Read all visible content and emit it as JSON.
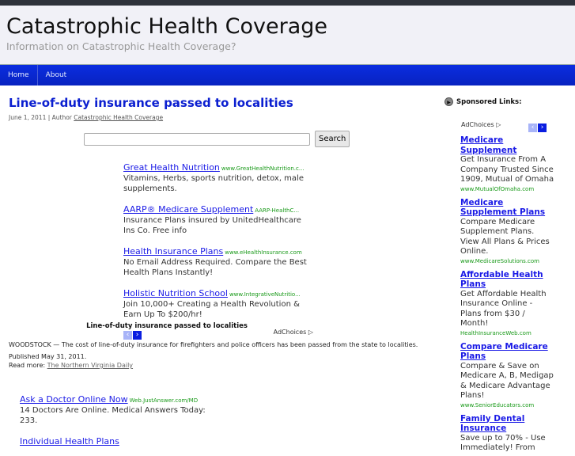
{
  "header": {
    "title": "Catastrophic Health Coverage",
    "tagline": "Information on Catastrophic Health Coverage?"
  },
  "nav": [
    "Home",
    "About"
  ],
  "post": {
    "title": "Line-of-duty insurance passed to localities",
    "date": "June 1, 2011 | Author ",
    "author": "Catastrophic Health Coverage",
    "caption": "Line-of-duty insurance passed to localities",
    "body": "WOODSTOCK — The cost of line-of-duty insurance for firefighters and police officers has been passed from the state to localities.",
    "published": "Published May 31, 2011.",
    "read_more": "Read more: ",
    "source": "The Northern Virginia Daily"
  },
  "search": {
    "button": "Search",
    "value": ""
  },
  "ads": [
    {
      "title": "Great Health Nutrition",
      "url": "www.GreatHealthNutrition.c...",
      "desc": "Vitamins, Herbs, sports nutrition, detox, male supplements."
    },
    {
      "title": "AARP® Medicare Supplement",
      "url": "AARP-HealthC...",
      "desc": "Insurance Plans insured by UnitedHealthcare Ins Co. Free info"
    },
    {
      "title": "Health Insurance Plans",
      "url": "www.eHealthInsurance.com",
      "desc": "No Email Address Required. Compare the Best Health Plans Instantly!"
    },
    {
      "title": "Holistic Nutrition School",
      "url": "www.IntegrativeNutritio...",
      "desc": "Join 10,000+ Creating a Health Revolution & Earn Up To $200/hr!"
    }
  ],
  "adchoices": "AdChoices",
  "ads2": [
    {
      "title": "Ask a Doctor Online Now",
      "url": "Web.JustAnswer.com/MD",
      "desc": "14 Doctors Are Online. Medical Answers Today: 233."
    },
    {
      "title": "Individual Health Plans"
    }
  ],
  "sidebar": {
    "heading": "Sponsored Links:",
    "ads": [
      {
        "title": "Medicare Supplement",
        "desc": "Get Insurance From A Company Trusted Since 1909, Mutual of Omaha",
        "url": "www.MutualOfOmaha.com"
      },
      {
        "title": "Medicare Supplement Plans",
        "desc": "Compare Medicare Supplement Plans. View All Plans & Prices Online.",
        "url": "www.MedicareSolutions.com"
      },
      {
        "title": "Affordable Health Plans",
        "desc": "Get Affordable Health Insurance Online - Plans from $30 / Month!",
        "url": "HealthInsuranceWeb.com"
      },
      {
        "title": "Compare Medicare Plans",
        "desc": "Compare & Save on Medicare A, B, Medigap & Medicare Advantage Plans!",
        "url": "www.SeniorEducators.com"
      },
      {
        "title": "Family Dental Insurance",
        "desc": "Save up to 70% - Use Immediately! From"
      }
    ]
  }
}
